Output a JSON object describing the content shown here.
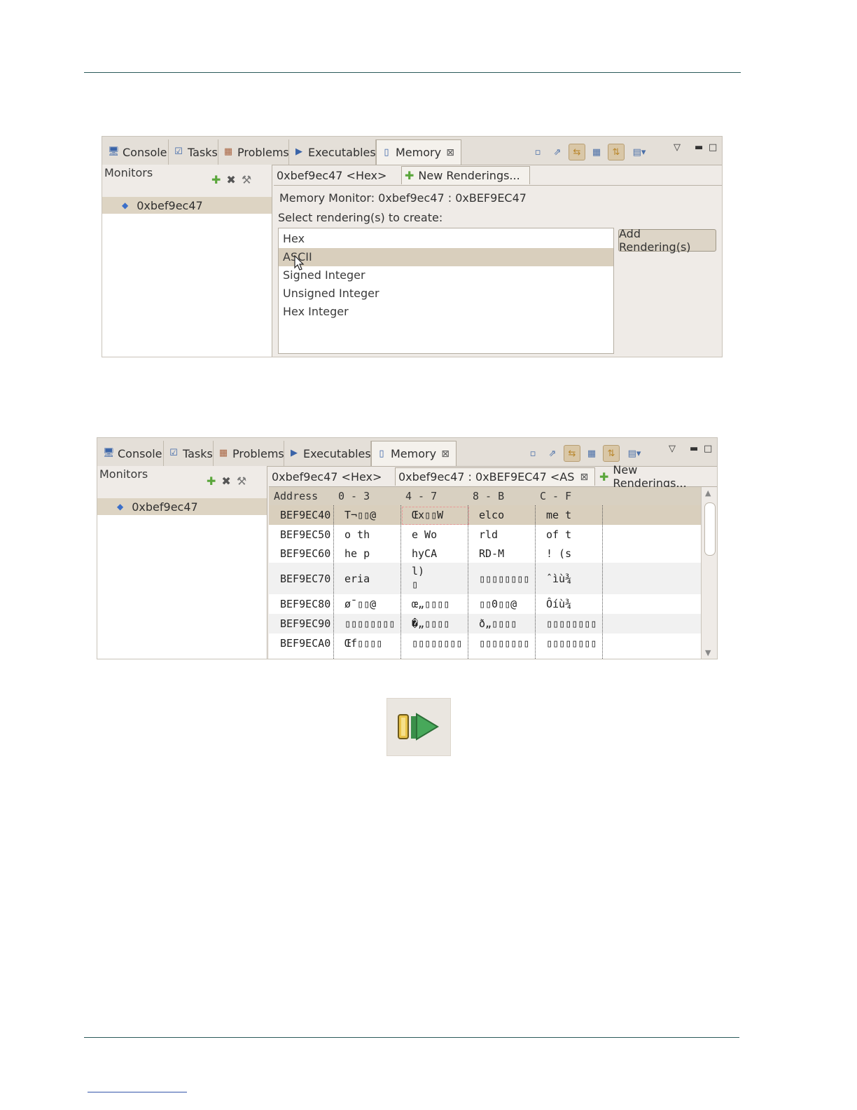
{
  "view_tabs": [
    {
      "label": "Console",
      "icon": "console-icon"
    },
    {
      "label": "Tasks",
      "icon": "tasks-icon"
    },
    {
      "label": "Problems",
      "icon": "problems-icon"
    },
    {
      "label": "Executables",
      "icon": "executables-icon"
    },
    {
      "label": "Memory",
      "icon": "memory-icon",
      "active": true
    }
  ],
  "toolbar_icons": [
    "new-memory-view-icon",
    "export-icon",
    "link-icon",
    "table-rendering-icon",
    "sync-icon",
    "layout-menu-icon"
  ],
  "monitors": {
    "title": "Monitors",
    "item": "0xbef9ec47"
  },
  "screen1": {
    "tabs": {
      "hex_tab": "0xbef9ec47 <Hex>",
      "new_rendering_tab": "New Renderings..."
    },
    "monitor_label": "Memory Monitor: 0xbef9ec47 : 0xBEF9EC47",
    "select_label": "Select rendering(s) to create:",
    "renderings": [
      "Hex",
      "ASCII",
      "Signed Integer",
      "Unsigned Integer",
      "Hex Integer"
    ],
    "selected_rendering": "ASCII",
    "add_button": "Add Rendering(s)"
  },
  "screen2": {
    "tabs": {
      "hex_tab": "0xbef9ec47 <Hex>",
      "ascii_tab": "0xbef9ec47 : 0xBEF9EC47 <AS",
      "new_rendering_tab": "New Renderings..."
    },
    "columns": [
      "Address",
      "0 - 3",
      "4 - 7",
      "8 - B",
      "C - F"
    ],
    "rows": [
      {
        "address": "BEF9EC40",
        "c0": "T¬▯▯@",
        "c1": "Œx▯▯W",
        "c2": "elco",
        "c3": "me t"
      },
      {
        "address": "BEF9EC50",
        "c0": "o th",
        "c1": "e Wo",
        "c2": "rld",
        "c3": "of t"
      },
      {
        "address": "BEF9EC60",
        "c0": "he p",
        "c1": "hyCA",
        "c2": "RD-M",
        "c3": "! (s"
      },
      {
        "address": "BEF9EC70",
        "c0": "eria",
        "c1": "l)",
        "c1b": "▯",
        "c2": "▯▯▯▯▯▯▯▯",
        "c3": "ˆìù¾"
      },
      {
        "address": "BEF9EC80",
        "c0": "ø¯▯▯@",
        "c1": "œ„▯▯▯▯",
        "c2": "▯▯0▯▯@",
        "c3": "Ôíù¾"
      },
      {
        "address": "BEF9EC90",
        "c0": "▯▯▯▯▯▯▯▯",
        "c1": "�„▯▯▯▯",
        "c2": "ð„▯▯▯▯",
        "c3": "▯▯▯▯▯▯▯▯"
      },
      {
        "address": "BEF9ECA0",
        "c0": "Œf▯▯▯▯",
        "c1": "▯▯▯▯▯▯▯▯",
        "c2": "▯▯▯▯▯▯▯▯",
        "c3": "▯▯▯▯▯▯▯▯"
      }
    ]
  },
  "launch_icon": "memory-rendering-launch-icon"
}
